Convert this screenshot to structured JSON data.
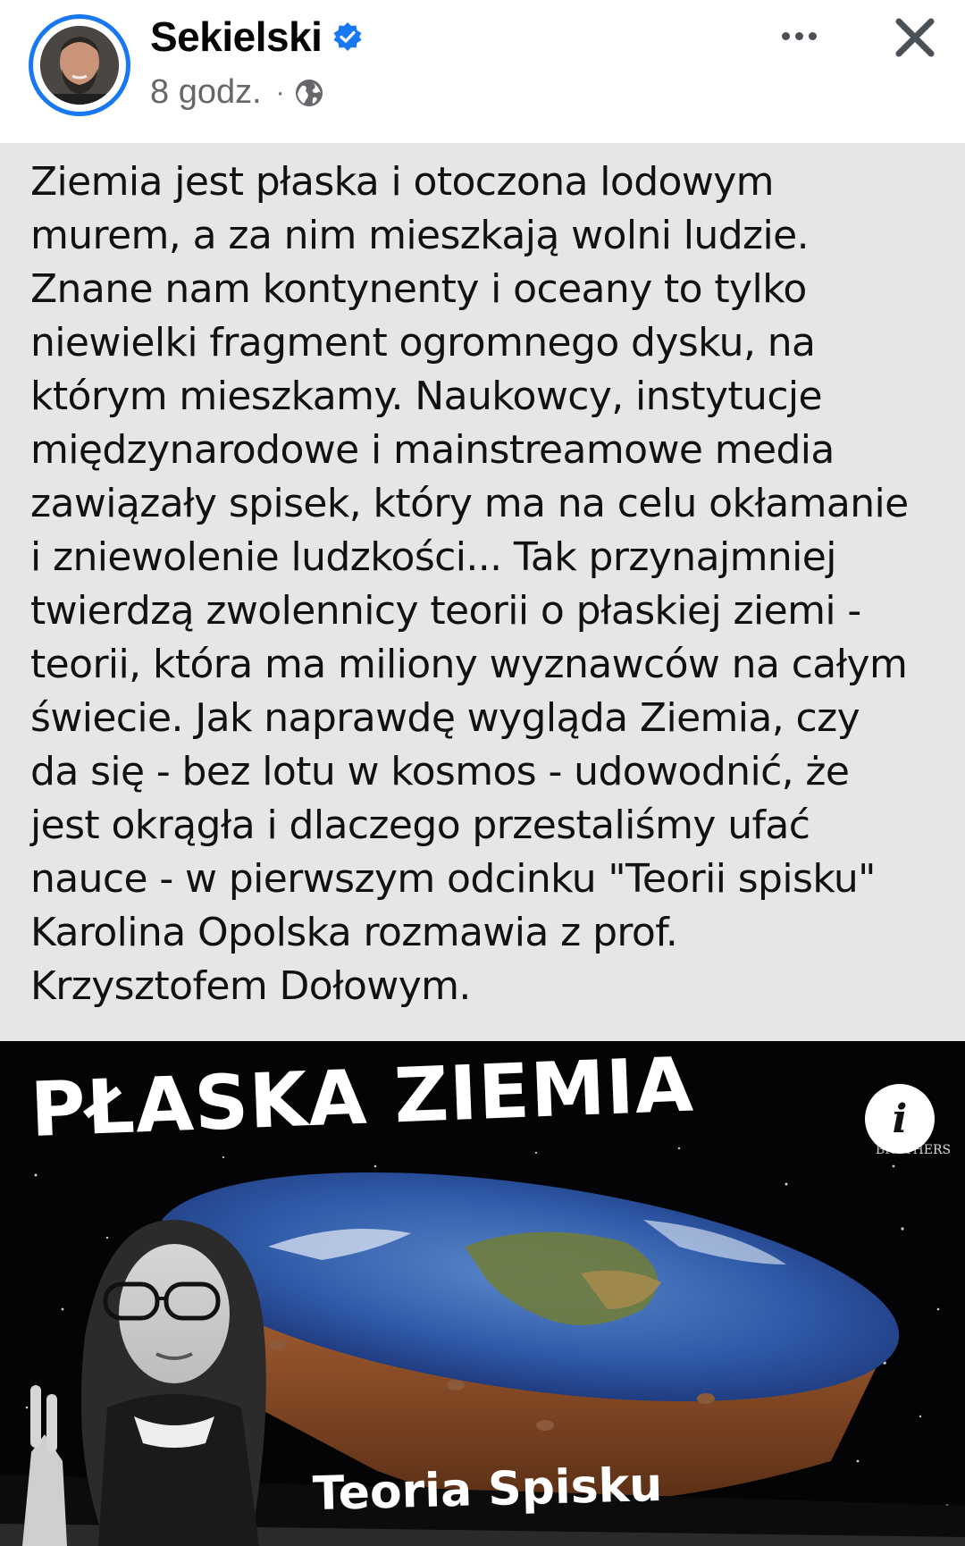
{
  "post": {
    "author": "Sekielski",
    "verified": true,
    "time": "8 godz.",
    "separator": "·",
    "audience_icon": "globe-icon",
    "text": "Ziemia jest płaska i otoczona lodowym\nmurem, a za nim mieszkają wolni ludzie.\nZnane nam kontynenty i oceany to tylko\nniewielki fragment ogromnego dysku, na\nktórym mieszkamy. Naukowcy, instytucje\nmiędzynarodowe i mainstreamowe media\nzawiązały spisek, który ma na celu okłamanie\ni zniewolenie ludzkości... Tak przynajmniej\ntwierdzą zwolennicy teorii o płaskiej ziemi -\nteorii, która ma miliony wyznawców na całym\nświecie. Jak naprawdę wygląda Ziemia, czy\nda się - bez lotu w kosmos - udowodnić, że\njest okrągła i dlaczego przestaliśmy ufać\nnauce - w pierwszym odcinku \"Teorii spisku\"\nKarolina Opolska rozmawia z prof.\nKrzysztofem Dołowym."
  },
  "header": {
    "more_icon": "more-options-icon",
    "close_icon": "close-icon"
  },
  "media": {
    "title": "PŁASKA ZIEMIA",
    "subtitle": "Teoria Spisku",
    "brand_text": "BROTHERS",
    "info_glyph": "i"
  },
  "colors": {
    "accent": "#1877f2",
    "text_panel_bg": "#e6e6e6",
    "meta_gray": "#65676b"
  }
}
